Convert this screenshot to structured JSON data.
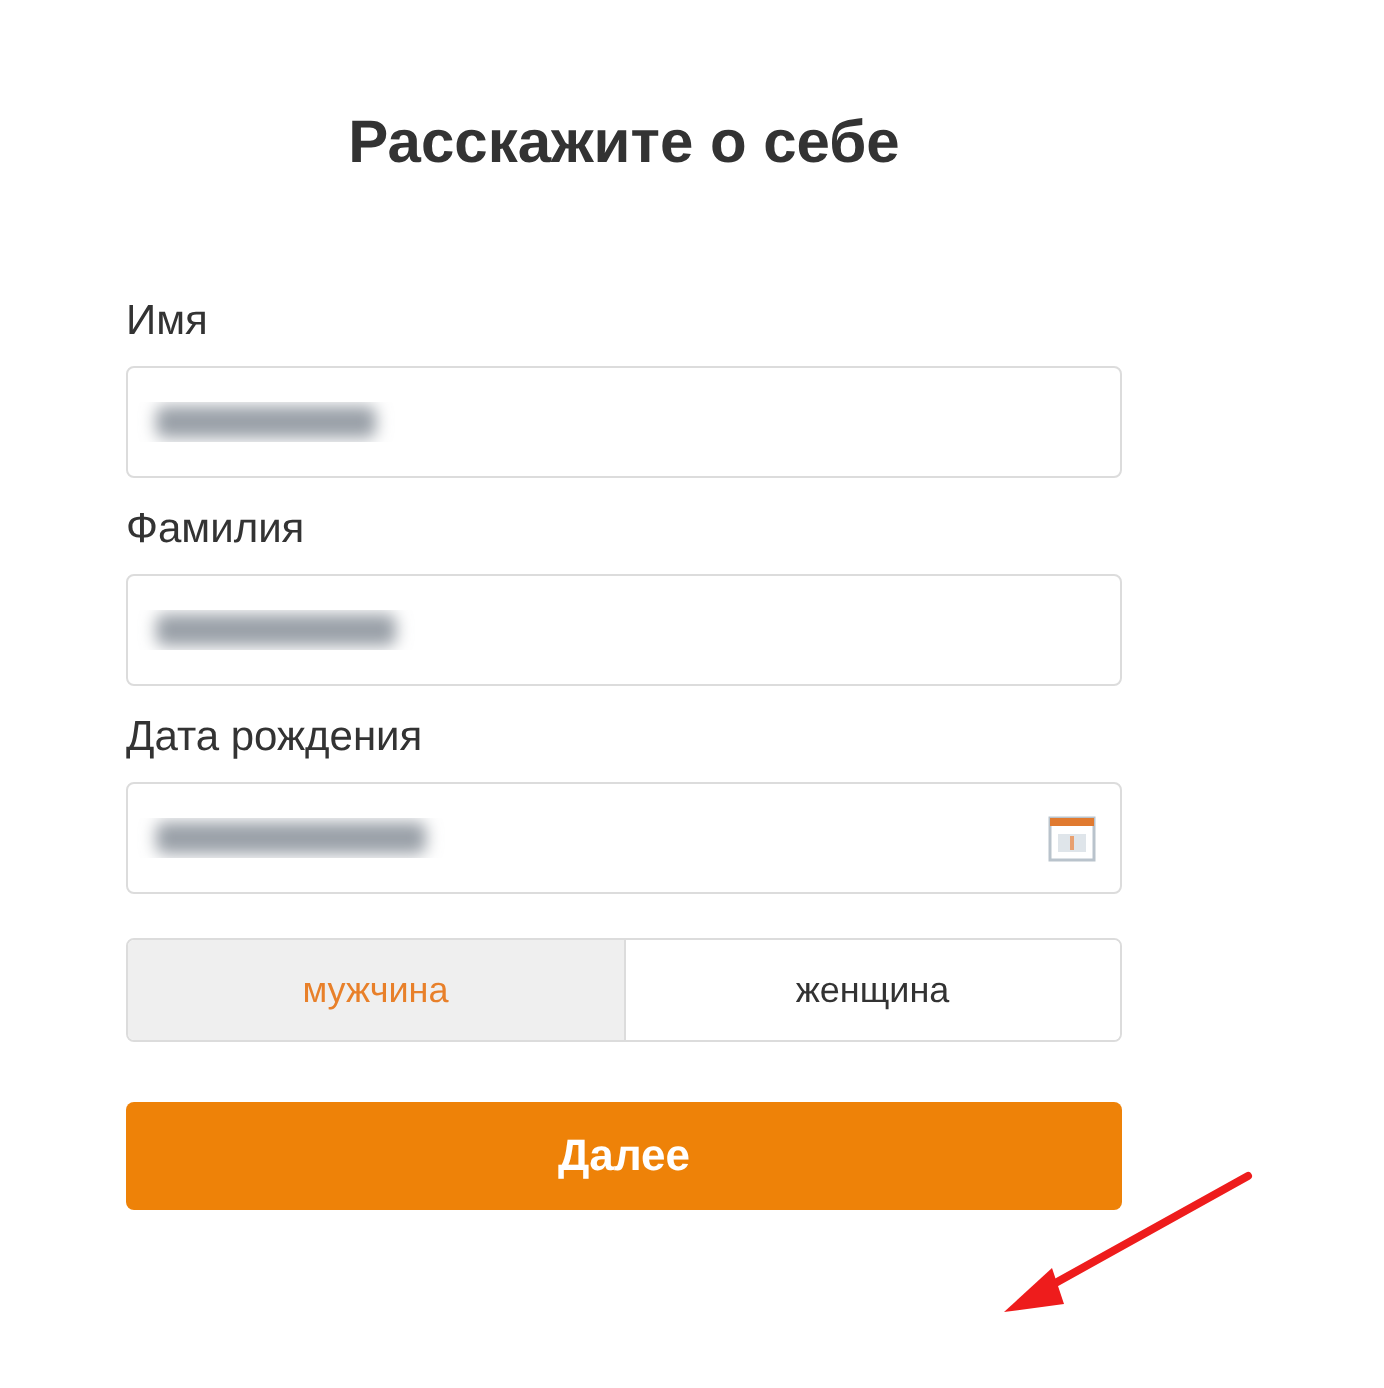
{
  "title": "Расскажите о себе",
  "fields": [
    {
      "label": "Имя",
      "kind": "text"
    },
    {
      "label": "Фамилия",
      "kind": "text"
    },
    {
      "label": "Дата рождения",
      "kind": "date"
    }
  ],
  "gender": [
    {
      "label": "мужчина",
      "selected": true
    },
    {
      "label": "женщина",
      "selected": false
    }
  ],
  "next_button": "Далее"
}
